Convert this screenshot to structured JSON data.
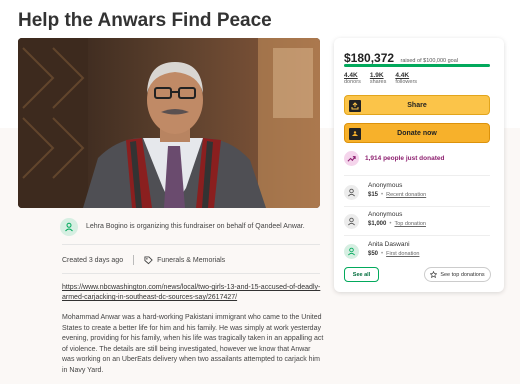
{
  "page": {
    "title": "Help the Anwars Find Peace"
  },
  "organizer": {
    "text": "Lehra Bogino is organizing this fundraiser on behalf of Qandeel Anwar.",
    "icon": "user-icon"
  },
  "meta": {
    "created": "Created 3 days ago",
    "category": "Funerals & Memorials"
  },
  "story": {
    "link": "https://www.nbcwashington.com/news/local/two-girls-13-and-15-accused-of-deadly-armed-carjacking-in-southeast-dc-sources-say/2617427/",
    "body": "Mohammad Anwar was a hard-working Pakistani immigrant who came to the United States to create a better life for him and his family. He was simply at work yesterday evening, providing for his family, when his life was tragically taken in an appalling act of violence. The details are still being investigated, however we know that Anwar was working on an UberEats delivery when two assailants attempted to carjack him in Navy Yard."
  },
  "card": {
    "amount": "$180,372",
    "goal": "raised of $100,000 goal",
    "progress_fraction": 1.0,
    "progress_color": "#02a95c",
    "stats": [
      {
        "value": "4.4K",
        "label": "donors"
      },
      {
        "value": "1.9K",
        "label": "shares"
      },
      {
        "value": "4.4K",
        "label": "followers"
      }
    ],
    "share_label": "Share",
    "donate_label": "Donate now",
    "trending": "1,914 people just donated",
    "donations": [
      {
        "name": "Anonymous",
        "amount": "$15",
        "tag": "Recent donation"
      },
      {
        "name": "Anonymous",
        "amount": "$1,000",
        "tag": "Top donation"
      },
      {
        "name": "Anita Daswani",
        "amount": "$50",
        "tag": "First donation"
      }
    ],
    "see_all": "See all",
    "see_top": "See top donations"
  }
}
